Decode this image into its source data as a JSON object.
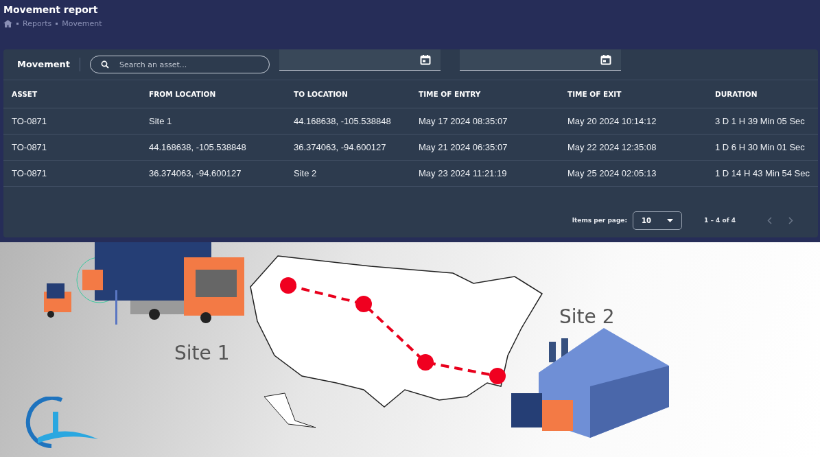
{
  "page": {
    "title": "Movement report",
    "breadcrumb": [
      "Reports",
      "Movement"
    ]
  },
  "card": {
    "title": "Movement",
    "search": {
      "placeholder": "Search an asset..."
    },
    "table": {
      "columns": [
        "ASSET",
        "FROM LOCATION",
        "TO LOCATION",
        "TIME OF ENTRY",
        "TIME OF EXIT",
        "DURATION"
      ],
      "rows": [
        [
          "TO-0871",
          "Site 1",
          "44.168638, -105.538848",
          "May 17 2024 08:35:07",
          "May 20 2024 10:14:12",
          "3 D 1 H 39 Min 05 Sec"
        ],
        [
          "TO-0871",
          "44.168638, -105.538848",
          "36.374063, -94.600127",
          "May 21 2024 06:35:07",
          "May 22 2024 12:35:08",
          "1 D 6 H 30 Min 01 Sec"
        ],
        [
          "TO-0871",
          "36.374063, -94.600127",
          "Site 2",
          "May 23 2024 11:21:19",
          "May 25 2024 02:05:13",
          "1 D 14 H 43 Min 54 Sec"
        ]
      ]
    },
    "pagination": {
      "label": "Items per page:",
      "page_size": "10",
      "range": "1 – 4 of 4"
    }
  },
  "illustration": {
    "labels": [
      "Site 1",
      "Site 2"
    ]
  }
}
